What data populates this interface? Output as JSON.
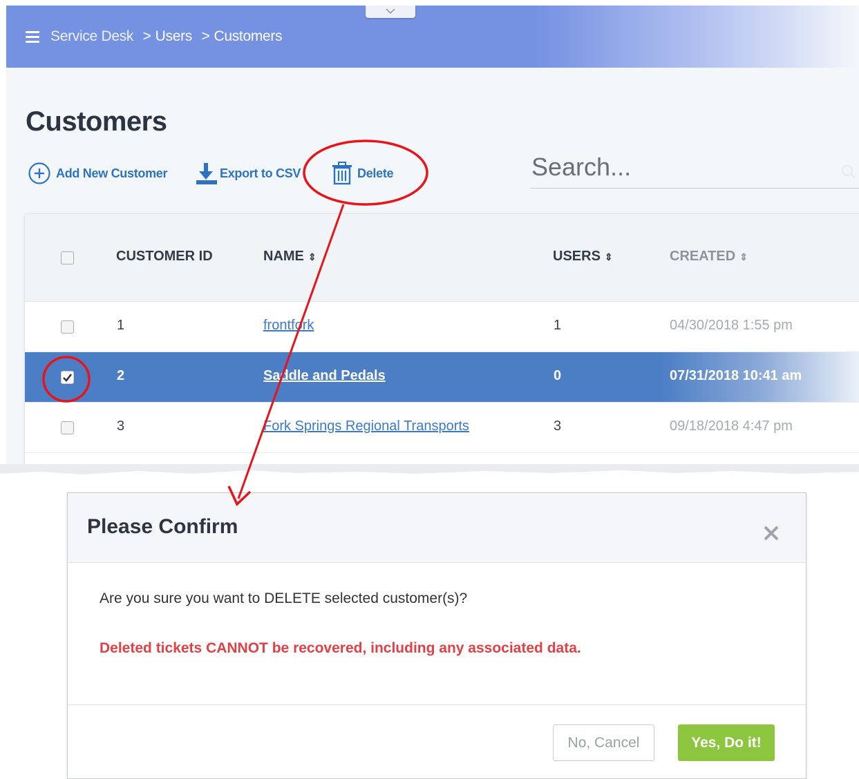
{
  "breadcrumb": {
    "root": "Service Desk",
    "level2": "Users",
    "level3": "Customers",
    "separator": ">"
  },
  "page": {
    "title": "Customers"
  },
  "toolbar": {
    "add_label": "Add New Customer",
    "export_label": "Export to CSV",
    "delete_label": "Delete"
  },
  "search": {
    "placeholder": "Search..."
  },
  "table": {
    "headers": {
      "customer_id": "CUSTOMER ID",
      "name": "NAME",
      "users": "USERS",
      "created": "CREATED",
      "sort_glyph": "⇕"
    },
    "rows": [
      {
        "id": "1",
        "name": "frontfork",
        "users": "1",
        "created": "04/30/2018 1:55 pm",
        "selected": false
      },
      {
        "id": "2",
        "name": "Saddle and Pedals",
        "users": "0",
        "created": "07/31/2018 10:41 am",
        "selected": true
      },
      {
        "id": "3",
        "name": "Fork Springs Regional Transports",
        "users": "3",
        "created": "09/18/2018 4:47 pm",
        "selected": false
      }
    ]
  },
  "dialog": {
    "title": "Please Confirm",
    "message": "Are you sure you want to DELETE selected customer(s)?",
    "warning": "Deleted tickets CANNOT be recovered, including any associated data.",
    "cancel_label": "No, Cancel",
    "confirm_label": "Yes, Do it!"
  },
  "colors": {
    "header": "#7591e2",
    "selected_row": "#4b7ec4",
    "link": "#2d73c4",
    "warning": "#e04146",
    "confirm_button": "#8cc63f",
    "annotation": "#e8141c"
  },
  "icons": [
    "hamburger-icon",
    "chevron-down-icon",
    "plus-circle-icon",
    "download-icon",
    "trash-icon",
    "search-icon",
    "close-icon",
    "sort-icon"
  ]
}
